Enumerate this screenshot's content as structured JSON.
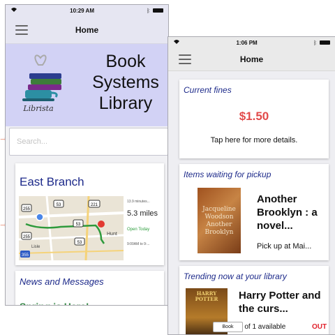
{
  "left_phone": {
    "status": {
      "time": "10:29 AM"
    },
    "navbar": {
      "title": "Home"
    },
    "library": {
      "logo_text": "Librista",
      "name_line1": "Book",
      "name_line2": "Systems",
      "name_line3": "Library"
    },
    "search": {
      "placeholder": "Search..."
    },
    "branch": {
      "title": "East Branch",
      "map_route_labels": [
        "255",
        "53",
        "221",
        "53",
        "255",
        "53",
        "355"
      ],
      "map_place_labels": [
        "Hunt",
        "Lisle"
      ],
      "duration": "13.9 minutes...",
      "distance": "5.3 miles",
      "open_status": "Open Today",
      "hours": "9:00AM to 9:..."
    },
    "news": {
      "title": "News and Messages",
      "headline": "Spring is Here!"
    }
  },
  "right_phone": {
    "status": {
      "time": "1:06 PM"
    },
    "navbar": {
      "title": "Home"
    },
    "fines": {
      "title": "Current fines",
      "amount": "$1.50",
      "details": "Tap here for more details."
    },
    "pickup": {
      "title": "Items waiting for pickup",
      "book_title": "Another Brooklyn : a novel...",
      "cover_text": "Jacqueline Woodson Another Brooklyn",
      "pickup_status": "Pick up at Mai..."
    },
    "trending": {
      "title": "Trending now at your library",
      "book_title": "Harry Potter and the curs...",
      "cover_text": "HARRY POTTER",
      "availability": "0 of 1 available",
      "out_label": "OUT",
      "format_label": "Book"
    }
  },
  "icons": [
    "wifi-icon",
    "battery-icon",
    "bluetooth-icon",
    "hamburger-menu-icon",
    "map-pin-icon",
    "location-dot-icon",
    "arrow-icon"
  ],
  "colors": {
    "header_bg": "#d2d2f5",
    "card_title": "#1d2a8a",
    "fines_amount": "#e24a4a",
    "open_status": "#2e9e3e",
    "out_label": "#e0212c"
  }
}
